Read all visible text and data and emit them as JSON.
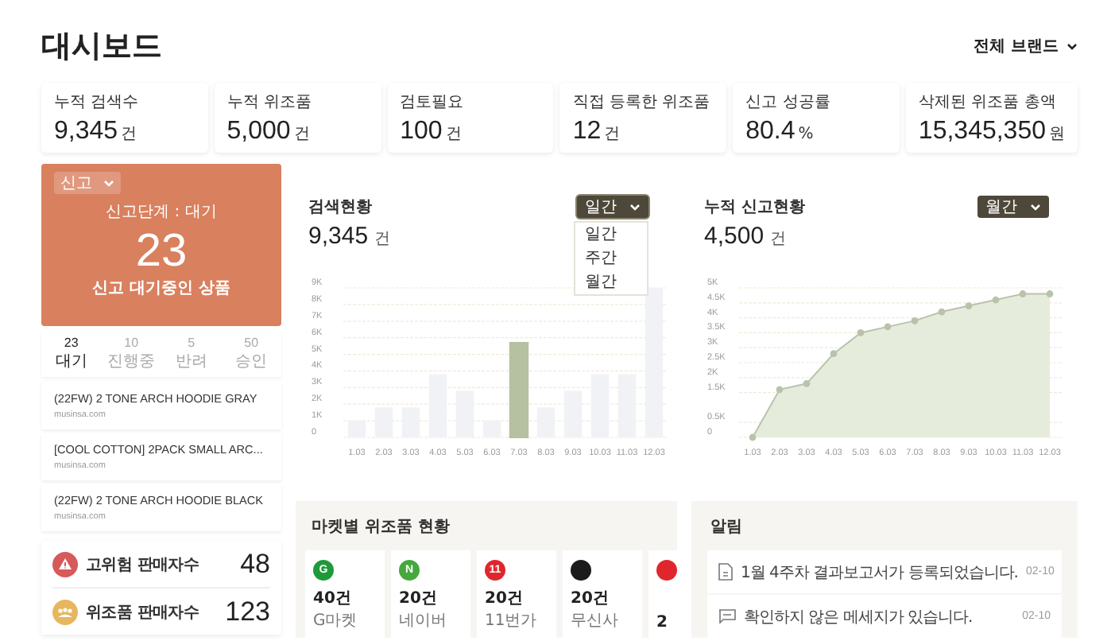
{
  "header": {
    "title": "대시보드",
    "brand_filter": "전체 브랜드"
  },
  "stats": [
    {
      "label": "누적 검색수",
      "value": "9,345",
      "unit": "건"
    },
    {
      "label": "누적 위조품",
      "value": "5,000",
      "unit": "건"
    },
    {
      "label": "검토필요",
      "value": "100",
      "unit": "건"
    },
    {
      "label": "직접 등록한 위조품",
      "value": "12",
      "unit": "건"
    },
    {
      "label": "신고 성공률",
      "value": "80.4",
      "unit": "%"
    },
    {
      "label": "삭제된 위조품 총액",
      "value": "15,345,350",
      "unit": "원"
    }
  ],
  "report": {
    "dropdown": "신고",
    "stage": "신고단계 : 대기",
    "count": "23",
    "caption": "신고 대기중인 상품",
    "tabs": [
      {
        "count": "23",
        "label": "대기",
        "selected": true
      },
      {
        "count": "10",
        "label": "진행중",
        "selected": false
      },
      {
        "count": "5",
        "label": "반려",
        "selected": false
      },
      {
        "count": "50",
        "label": "승인",
        "selected": false
      }
    ],
    "items": [
      {
        "name": "(22FW) 2 TONE ARCH HOODIE GRAY",
        "site": "musinsa.com"
      },
      {
        "name": "[COOL COTTON] 2PACK SMALL ARC...",
        "site": "musinsa.com"
      },
      {
        "name": "(22FW) 2 TONE ARCH HOODIE BLACK",
        "site": "musinsa.com"
      }
    ]
  },
  "sellers": [
    {
      "kind": "risk",
      "label": "고위험 판매자수",
      "value": "48"
    },
    {
      "kind": "fake",
      "label": "위조품 판매자수",
      "value": "123"
    }
  ],
  "search_chart": {
    "title": "검색현황",
    "value": "9,345",
    "unit": "건",
    "period": "일간",
    "menu_open": true,
    "menu": [
      "일간",
      "주간",
      "월간"
    ],
    "chart_data": {
      "type": "bar",
      "categories": [
        "1.03",
        "2.03",
        "3.03",
        "4.03",
        "5.03",
        "6.03",
        "7.03",
        "8.03",
        "9.03",
        "10.03",
        "11.03",
        "12.03"
      ],
      "series": [
        {
          "color": "#f1f2f5",
          "values": [
            1000,
            1800,
            1800,
            3800,
            2800,
            1000,
            null,
            1800,
            2800,
            3800,
            3800,
            9000
          ]
        },
        {
          "color": "#b5c1a1",
          "values": [
            null,
            null,
            null,
            null,
            null,
            null,
            5700,
            null,
            null,
            null,
            null,
            null
          ]
        }
      ],
      "grid": true,
      "ylim": [
        0,
        9000
      ],
      "yticks": [
        {
          "value": 0,
          "label": "0"
        },
        {
          "value": 1000,
          "label": "1K"
        },
        {
          "value": 2000,
          "label": "2K"
        },
        {
          "value": 3000,
          "label": "3K"
        },
        {
          "value": 4000,
          "label": "4K"
        },
        {
          "value": 5000,
          "label": "5K"
        },
        {
          "value": 6000,
          "label": "6K"
        },
        {
          "value": 7000,
          "label": "7K"
        },
        {
          "value": 8000,
          "label": "8K"
        },
        {
          "value": 9000,
          "label": "9K"
        }
      ]
    }
  },
  "report_chart": {
    "title": "누적 신고현황",
    "value": "4,500",
    "unit": "건",
    "period": "월간",
    "menu_open": false,
    "chart_data": {
      "type": "area",
      "x": [
        "1.03",
        "2.03",
        "3.03",
        "4.03",
        "5.03",
        "6.03",
        "7.03",
        "8.03",
        "9.03",
        "10.03",
        "11.03",
        "12.03"
      ],
      "series": [
        {
          "color": "#b9c3aa",
          "values": [
            0,
            1600,
            1800,
            2800,
            3500,
            3700,
            3900,
            4200,
            4400,
            4600,
            4800,
            4800
          ]
        }
      ],
      "grid": true,
      "ylim": [
        0,
        5000
      ],
      "yticks": [
        {
          "value": 0,
          "label": "0"
        },
        {
          "value": 500,
          "label": "0.5K"
        },
        {
          "value": 1500,
          "label": "1.5K"
        },
        {
          "value": 2000,
          "label": "2K"
        },
        {
          "value": 2500,
          "label": "2.5K"
        },
        {
          "value": 3000,
          "label": "3K"
        },
        {
          "value": 3500,
          "label": "3.5K"
        },
        {
          "value": 4000,
          "label": "4K"
        },
        {
          "value": 4500,
          "label": "4.5K"
        },
        {
          "value": 5000,
          "label": "5K"
        }
      ]
    }
  },
  "markets": {
    "title": "마켓별 위조품  현황",
    "items": [
      {
        "logo": "G",
        "color": "#1f9a3a",
        "count": "40건",
        "name": "G마켓"
      },
      {
        "logo": "N",
        "color": "#45a83c",
        "count": "20건",
        "name": "네이버"
      },
      {
        "logo": "11",
        "color": "#e0262c",
        "count": "20건",
        "name": "11번가"
      },
      {
        "color": "#1b1b1b",
        "count": "20건",
        "name": "무신사"
      },
      {
        "color": "#e0262c",
        "count": "2"
      }
    ]
  },
  "alerts": {
    "title": "알림",
    "items": [
      {
        "kind": "report",
        "text": "1월 4주차 결과보고서가 등록되었습니다.",
        "date": "02-10"
      },
      {
        "kind": "message",
        "text": "확인하지 않은 메세지가 있습니다.",
        "date": "02-10"
      }
    ]
  }
}
